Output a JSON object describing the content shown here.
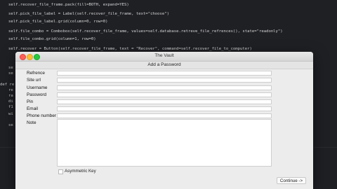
{
  "editor": {
    "lines": [
      "self.recover_file_frame.pack(fill=BOTH, expand=YES)",
      "self.pick_file_label = Label(self.recover_file_frame, text=\"choose\")",
      "self.pick_file_label.grid(column=0, row=0)",
      "self.file_combo = Combobox(self.recover_file_frame, values=self.database.retreve_file_refrences(), state=\"readonly\")",
      "self.file_combo.grid(column=1, row=0)",
      "self.recover = Button(self.recover_file_frame, text = \"Recover\", command=self.recover_file_to_computer)"
    ],
    "gutter_fragments": [
      "se",
      "se",
      "def re",
      "re",
      "ra",
      "di",
      "f1",
      "wi",
      "se"
    ]
  },
  "window": {
    "title": "The Vault",
    "header": "Add a Password",
    "fields": [
      {
        "label": "Refrence"
      },
      {
        "label": "Site url"
      },
      {
        "label": "Username"
      },
      {
        "label": "Password"
      },
      {
        "label": "Pin"
      },
      {
        "label": "Email"
      },
      {
        "label": "Phone number"
      },
      {
        "label": "Note"
      }
    ],
    "checkbox_label": "Asymmetric Key",
    "continue_label": "Continue ->"
  }
}
